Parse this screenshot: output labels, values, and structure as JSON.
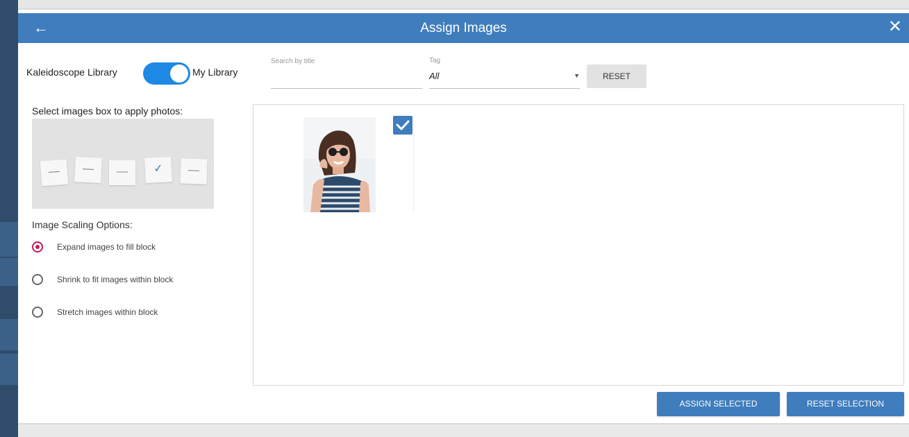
{
  "header": {
    "title": "Assign Images",
    "back_icon": "←",
    "close_icon": "✕"
  },
  "library": {
    "left_label": "Kaleidoscope Library",
    "right_label": "My Library",
    "toggle_on": true
  },
  "layout_picker": {
    "label": "Select images box to apply photos:",
    "slots": [
      "—",
      "—",
      "—",
      "✓",
      "—"
    ]
  },
  "scaling": {
    "label": "Image Scaling Options:",
    "options": [
      {
        "label": "Expand images to fill block",
        "selected": true
      },
      {
        "label": "Shrink to fit images within block",
        "selected": false
      },
      {
        "label": "Stretch images within block",
        "selected": false
      }
    ]
  },
  "filters": {
    "search_placeholder": "Search by title",
    "tag_label": "Tag",
    "tag_value": "All",
    "reset_label": "RESET"
  },
  "grid": {
    "selected_count": 1
  },
  "actions": {
    "assign_label": "ASSIGN SELECTED",
    "reset_selection_label": "RESET SELECTION"
  },
  "colors": {
    "accent": "#3f7dbd",
    "toggle": "#1e88e5",
    "radio_selected": "#c2185b"
  }
}
